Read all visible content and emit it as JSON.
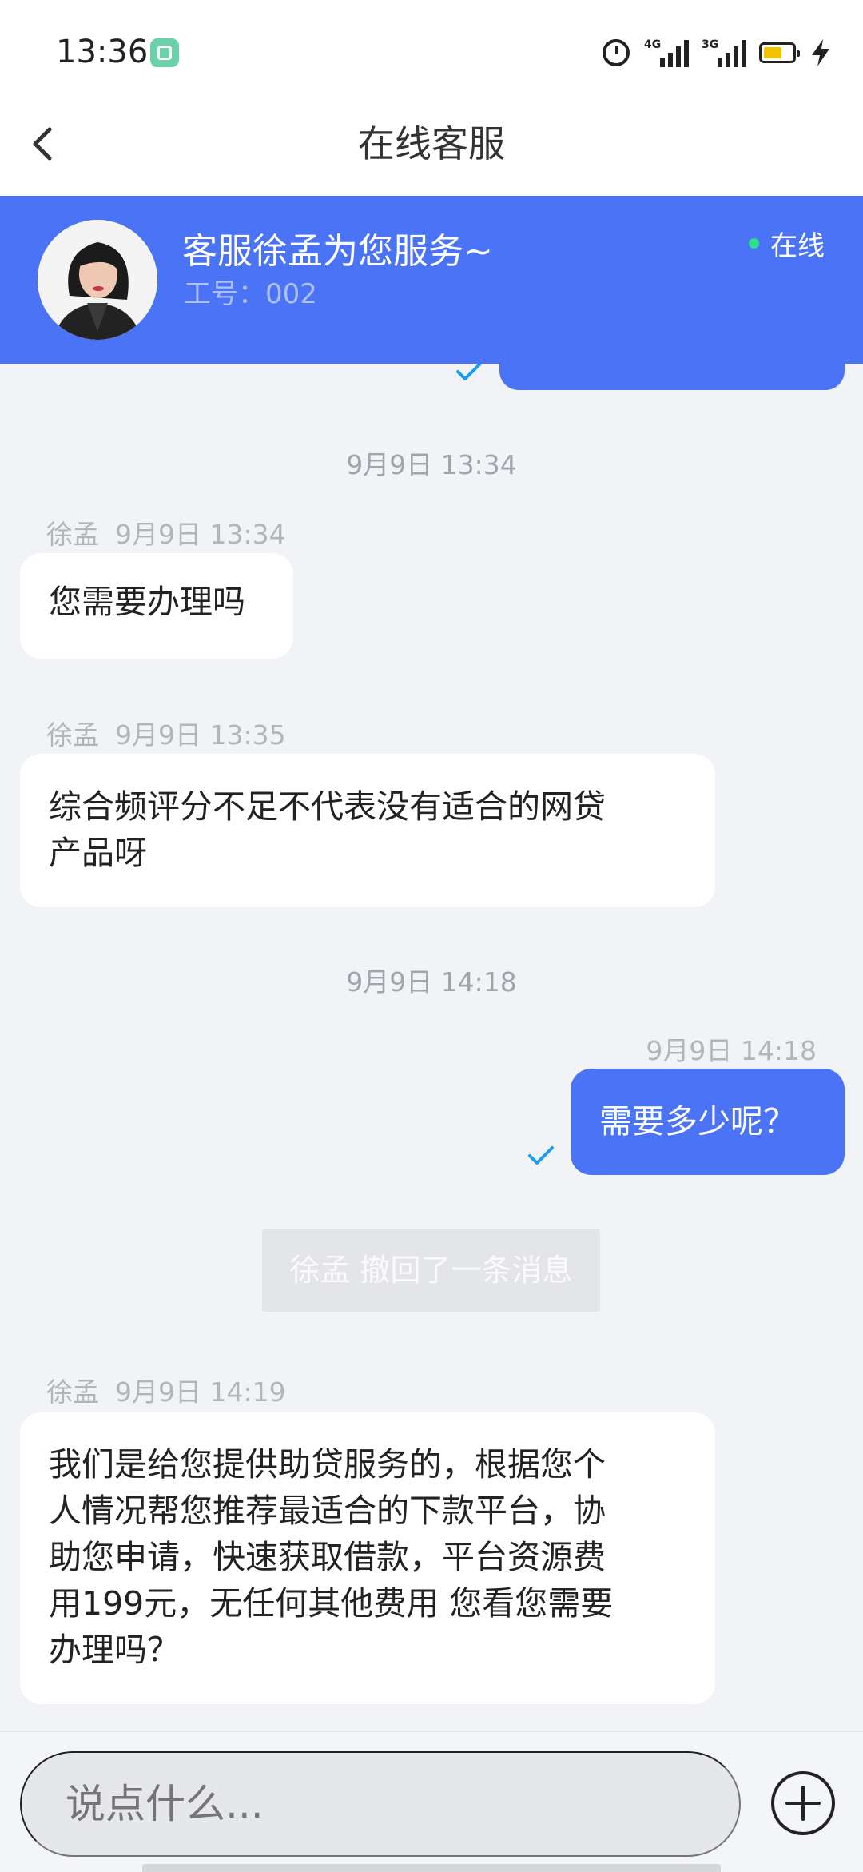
{
  "status_bar": {
    "time": "13:36",
    "network_1": "4G",
    "network_2": "3G"
  },
  "header": {
    "title": "在线客服"
  },
  "agent": {
    "greeting": "客服徐孟为您服务~",
    "employee_id": "工号：002",
    "status": "在线",
    "status_color": "#2ee08c"
  },
  "messages": {
    "ts1": "9月9日 13:34",
    "m1_sender": "徐孟",
    "m1_time": "9月9日 13:34",
    "m1_text": "您需要办理吗",
    "m2_sender": "徐孟",
    "m2_time": "9月9日 13:35",
    "m2_text_line1": "综合频评分不足不代表没有适合的网贷",
    "m2_text_line2": "产品呀",
    "ts2": "9月9日 14:18",
    "m3_time": "9月9日 14:18",
    "m3_text": "需要多少呢？",
    "recall_notice": "徐孟 撤回了一条消息",
    "m4_sender": "徐孟",
    "m4_time": "9月9日 14:19",
    "m4_lines": [
      "我们是给您提供助贷服务的，根据您个",
      "人情况帮您推荐最适合的下款平台，协",
      "助您申请，快速获取借款，平台资源费",
      "用199元，无任何其他费用 您看您需要",
      "办理吗？"
    ]
  },
  "composer": {
    "placeholder": "说点什么..."
  },
  "colors": {
    "accent": "#4a74f5",
    "background": "#f1f3f7",
    "read_check": "#1d9bf0"
  }
}
